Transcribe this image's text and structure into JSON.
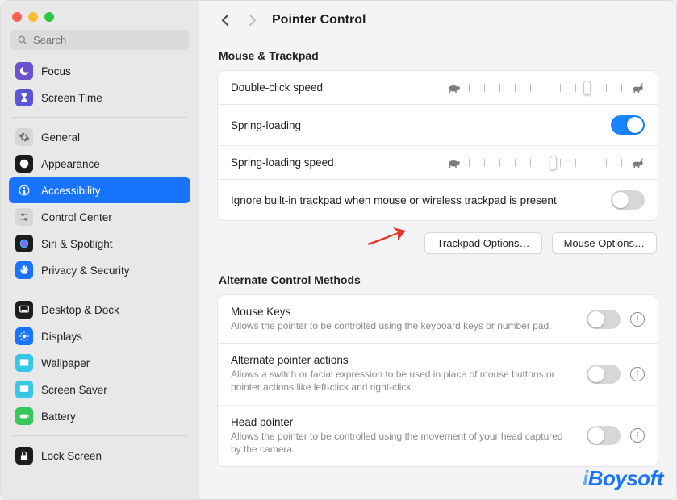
{
  "search": {
    "placeholder": "Search"
  },
  "sidebar": {
    "groups": [
      {
        "items": [
          {
            "label": "Focus",
            "icon": "moon-icon",
            "bg": "#6c52cc",
            "fg": "#ffffff"
          },
          {
            "label": "Screen Time",
            "icon": "hourglass-icon",
            "bg": "#5856d6",
            "fg": "#ffffff"
          }
        ]
      },
      {
        "items": [
          {
            "label": "General",
            "icon": "gear-icon",
            "bg": "#d7d6d8",
            "fg": "#6f6f72"
          },
          {
            "label": "Appearance",
            "icon": "appearance-icon",
            "bg": "#1c1c1e",
            "fg": "#ffffff"
          },
          {
            "label": "Accessibility",
            "icon": "accessibility-icon",
            "bg": "#1874ff",
            "fg": "#ffffff",
            "selected": true
          },
          {
            "label": "Control Center",
            "icon": "sliders-icon",
            "bg": "#d7d6d8",
            "fg": "#6f6f72"
          },
          {
            "label": "Siri & Spotlight",
            "icon": "siri-icon",
            "bg": "#1c1c1e",
            "fg": "#ffffff"
          },
          {
            "label": "Privacy & Security",
            "icon": "hand-icon",
            "bg": "#1874ff",
            "fg": "#ffffff"
          }
        ]
      },
      {
        "items": [
          {
            "label": "Desktop & Dock",
            "icon": "dock-icon",
            "bg": "#1c1c1e",
            "fg": "#ffffff"
          },
          {
            "label": "Displays",
            "icon": "display-icon",
            "bg": "#1874ff",
            "fg": "#ffffff"
          },
          {
            "label": "Wallpaper",
            "icon": "wallpaper-icon",
            "bg": "#36c7e8",
            "fg": "#ffffff"
          },
          {
            "label": "Screen Saver",
            "icon": "screensaver-icon",
            "bg": "#36c7e8",
            "fg": "#ffffff"
          },
          {
            "label": "Battery",
            "icon": "battery-icon",
            "bg": "#34c759",
            "fg": "#ffffff"
          }
        ]
      },
      {
        "items": [
          {
            "label": "Lock Screen",
            "icon": "lock-icon",
            "bg": "#1c1c1e",
            "fg": "#ffffff"
          }
        ]
      }
    ]
  },
  "header": {
    "title": "Pointer Control"
  },
  "section1": {
    "title": "Mouse & Trackpad",
    "rows": {
      "doubleClick": {
        "label": "Double-click speed",
        "sliderPercent": 78
      },
      "springLoading": {
        "label": "Spring-loading",
        "on": true
      },
      "springSpeed": {
        "label": "Spring-loading speed",
        "sliderPercent": 55
      },
      "ignoreTrackpad": {
        "label": "Ignore built-in trackpad when mouse or wireless trackpad is present",
        "on": false
      }
    },
    "buttons": {
      "trackpad": "Trackpad Options…",
      "mouse": "Mouse Options…"
    }
  },
  "section2": {
    "title": "Alternate Control Methods",
    "rows": {
      "mouseKeys": {
        "label": "Mouse Keys",
        "desc": "Allows the pointer to be controlled using the keyboard keys or number pad.",
        "on": false
      },
      "altPointer": {
        "label": "Alternate pointer actions",
        "desc": "Allows a switch or facial expression to be used in place of mouse buttons or pointer actions like left-click and right-click.",
        "on": false
      },
      "headPointer": {
        "label": "Head pointer",
        "desc": "Allows the pointer to be controlled using the movement of your head captured by the camera.",
        "on": false
      }
    }
  },
  "watermark": "iBoysoft",
  "colors": {
    "accent": "#1874ff"
  }
}
